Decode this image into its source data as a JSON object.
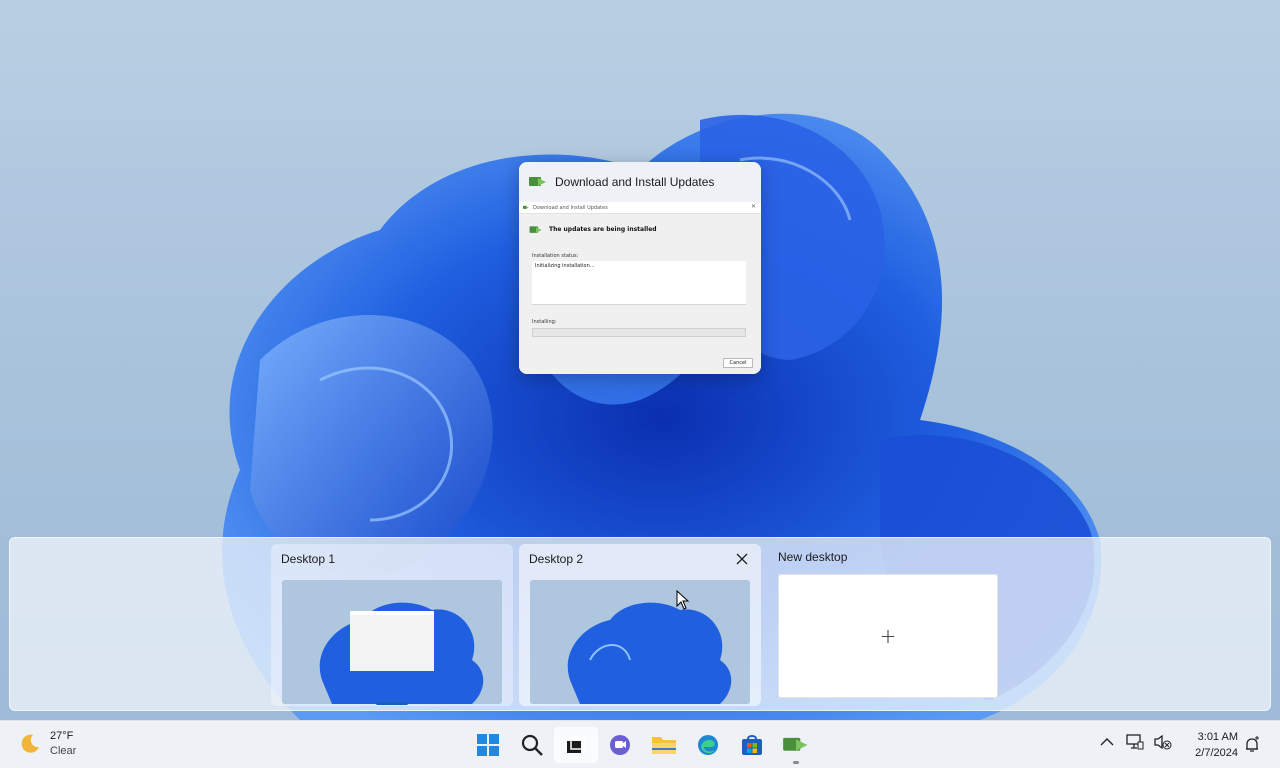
{
  "window_card": {
    "title": "Download and Install Updates",
    "inner_title": "Download and Install Updates",
    "heading": "The updates are being installed",
    "installation_status_label": "Installation status:",
    "status_text": "Initializing installation...",
    "installing_label": "Installing:",
    "cancel_label": "Cancel"
  },
  "desktops": {
    "items": [
      {
        "label": "Desktop 1"
      },
      {
        "label": "Desktop 2"
      }
    ],
    "new_desktop_label": "New desktop",
    "plus": "+"
  },
  "taskbar": {
    "weather": {
      "temp": "27°F",
      "condition": "Clear"
    },
    "clock": {
      "time": "3:01 AM",
      "date": "2/7/2024"
    },
    "pinned": [
      "windows-start-icon",
      "search-icon",
      "task-view-icon",
      "teams-chat-icon",
      "file-explorer-icon",
      "edge-icon",
      "store-icon",
      "update-installer-icon"
    ]
  },
  "colors": {
    "accent": "#1a5fb4",
    "bloom_blue": "#1f5fe0",
    "taskbar_bg": "#eef2f7"
  }
}
